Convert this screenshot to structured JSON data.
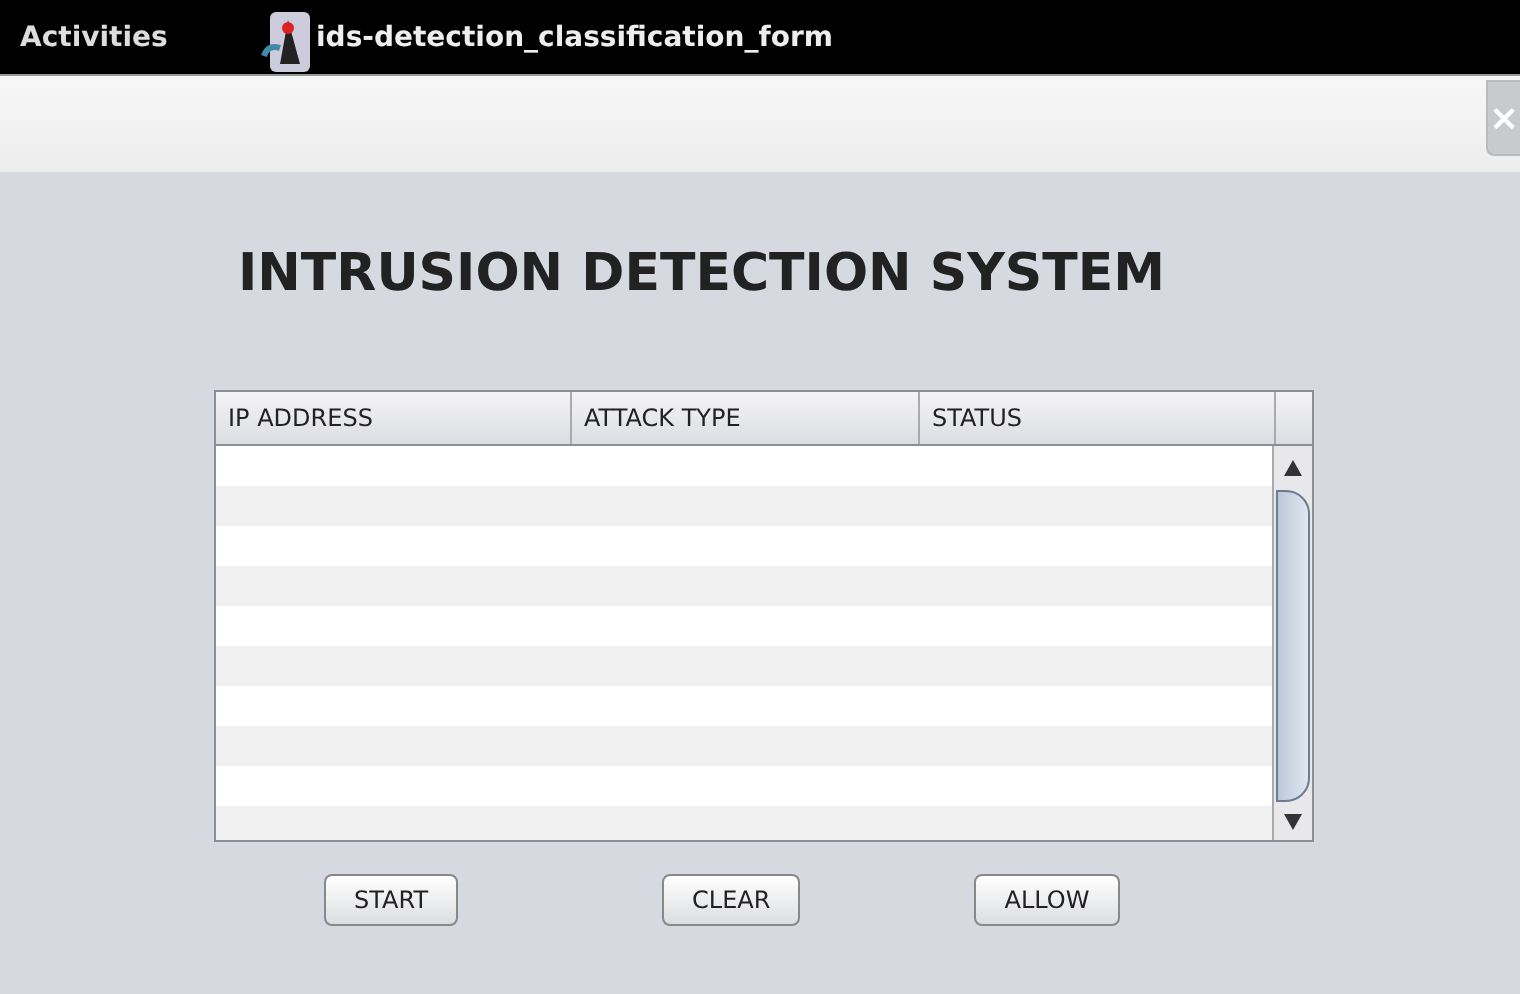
{
  "top_bar": {
    "activities": "Activities",
    "app_title": "ids-detection_classification_form"
  },
  "window": {
    "close": "×"
  },
  "heading": "INTRUSION DETECTION SYSTEM",
  "table": {
    "columns": [
      "IP ADDRESS",
      "ATTACK TYPE",
      "STATUS"
    ]
  },
  "buttons": [
    "START",
    "CLEAR",
    "ALLOW"
  ]
}
